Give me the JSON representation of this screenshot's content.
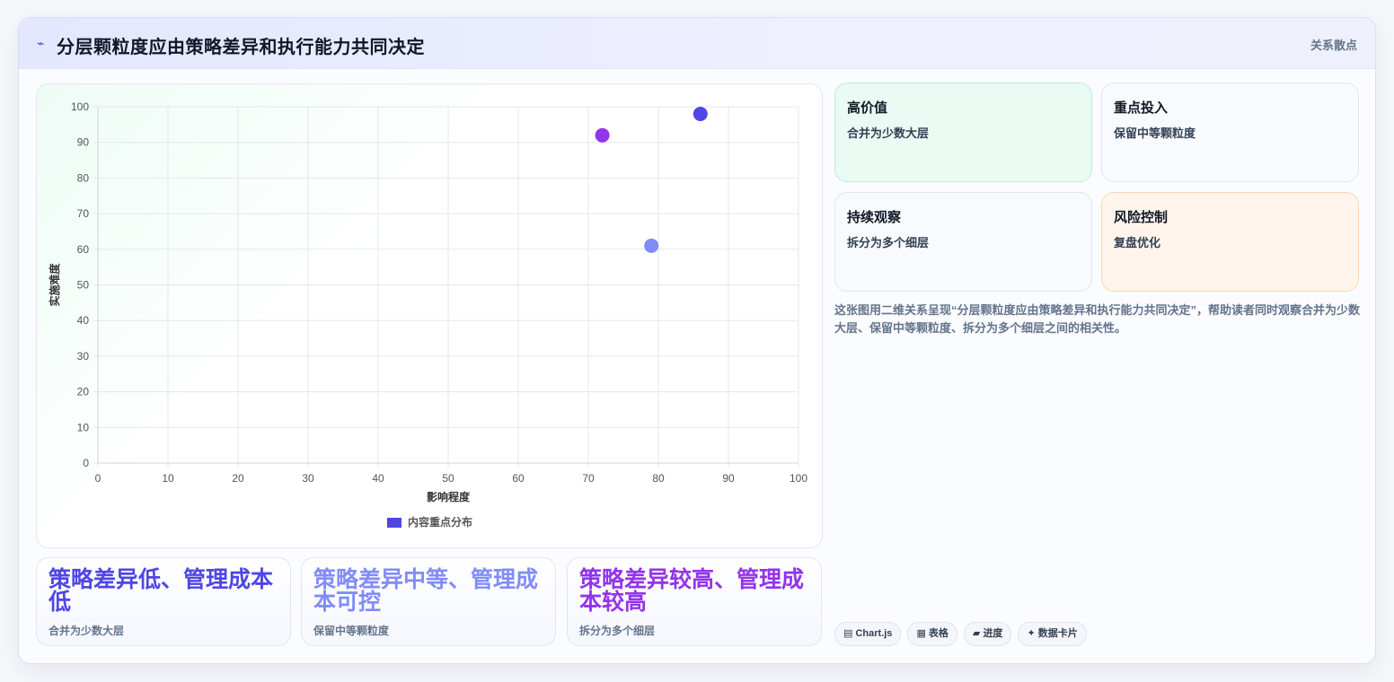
{
  "header": {
    "icon": "lightning-icon",
    "title": "分层颗粒度应由策略差异和执行能力共同决定",
    "tag": "关系散点"
  },
  "chart_data": {
    "type": "scatter",
    "title": "",
    "xlabel": "影响程度",
    "ylabel": "实施难度",
    "xlim": [
      0,
      100
    ],
    "ylim": [
      0,
      100
    ],
    "xticks": [
      0,
      10,
      20,
      30,
      40,
      50,
      60,
      70,
      80,
      90,
      100
    ],
    "yticks": [
      0,
      10,
      20,
      30,
      40,
      50,
      60,
      70,
      80,
      90,
      100
    ],
    "grid": true,
    "legend_position": "bottom",
    "series": [
      {
        "name": "内容重点分布",
        "color": "#4f46e5",
        "points": [
          {
            "x": 72,
            "y": 92,
            "color": "#9333ea"
          },
          {
            "x": 86,
            "y": 98,
            "color": "#4f46e5"
          },
          {
            "x": 79,
            "y": 61,
            "color": "#818cf8"
          }
        ]
      }
    ]
  },
  "stats": [
    {
      "title": "策略差异低、管理成本低",
      "sub": "合并为少数大层",
      "color": "#4f46e5"
    },
    {
      "title": "策略差异中等、管理成本可控",
      "sub": "保留中等颗粒度",
      "color": "#818cf8"
    },
    {
      "title": "策略差异较高、管理成本较高",
      "sub": "拆分为多个细层",
      "color": "#9333ea"
    }
  ],
  "quadrants": [
    {
      "title": "高价值",
      "sub": "合并为少数大层",
      "bg": "#eafbf3",
      "border": "#bfeed6"
    },
    {
      "title": "重点投入",
      "sub": "保留中等颗粒度",
      "bg": "#f8fafe",
      "border": "#e0e5f3"
    },
    {
      "title": "持续观察",
      "sub": "拆分为多个细层",
      "bg": "#f8fafe",
      "border": "#e0e5f3"
    },
    {
      "title": "风险控制",
      "sub": "复盘优化",
      "bg": "#fff5ec",
      "border": "#f8d9b8"
    }
  ],
  "description": "这张图用二维关系呈现“分层颗粒度应由策略差异和执行能力共同决定”，帮助读者同时观察合并为少数大层、保留中等颗粒度、拆分为多个细层之间的相关性。",
  "chips": [
    {
      "icon": "bar-chart-icon",
      "glyph": "▤",
      "label": "Chart.js"
    },
    {
      "icon": "table-icon",
      "glyph": "▦",
      "label": "表格"
    },
    {
      "icon": "progress-icon",
      "glyph": "▰",
      "label": "进度"
    },
    {
      "icon": "sparkle-icon",
      "glyph": "✦",
      "label": "数据卡片"
    }
  ]
}
